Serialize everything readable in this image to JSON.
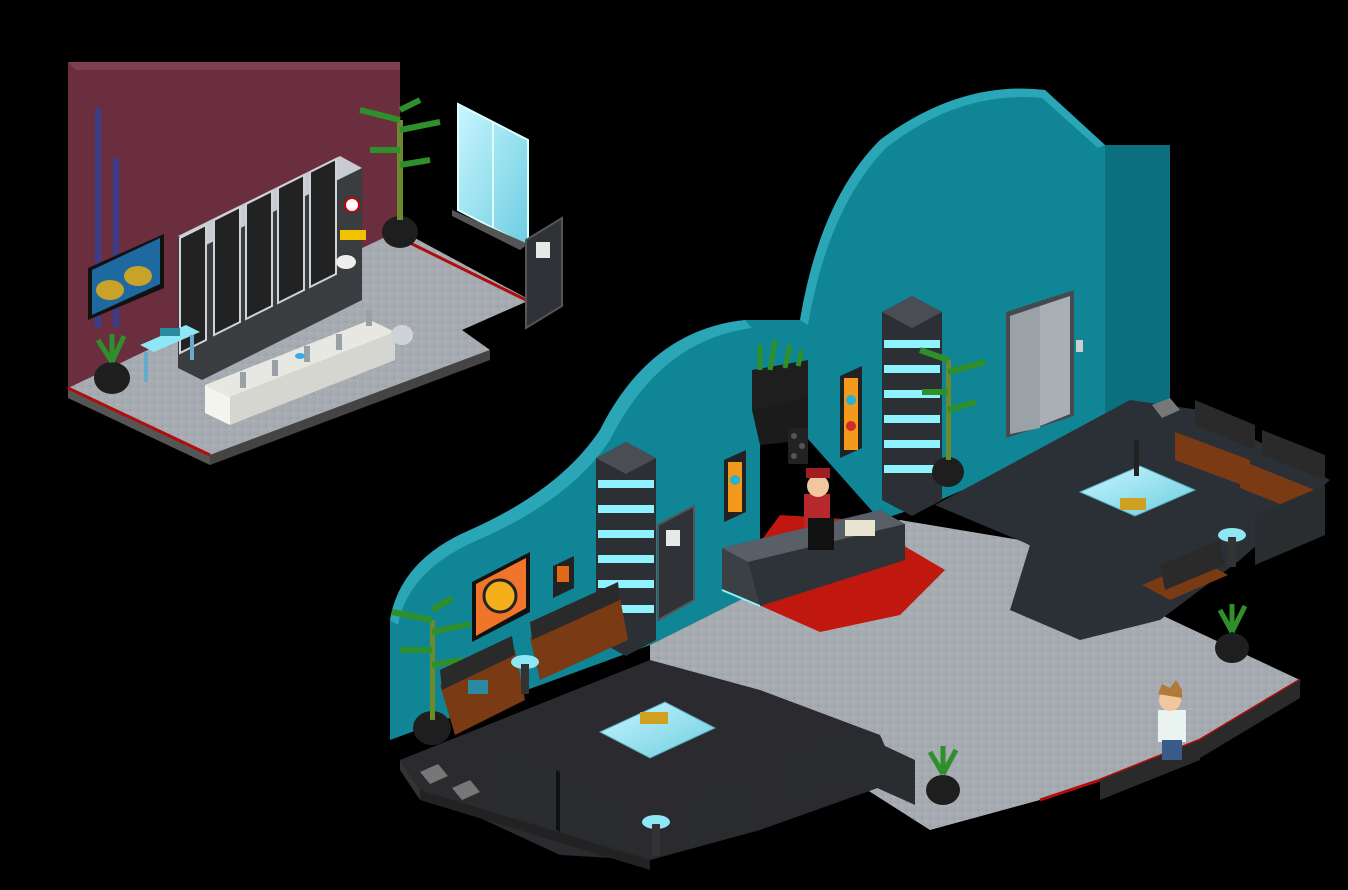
{
  "scene": {
    "background": "#000000",
    "rooms": [
      {
        "id": "restroom",
        "wall_color": "#6a2e3e",
        "floor_color": "#9a9fa6"
      },
      {
        "id": "lobby",
        "wall_color": "#0f8596",
        "floor_color": "#a7acb2",
        "carpet_color": "#2a3036",
        "rug_color": "#c0180e"
      }
    ],
    "colors": {
      "pillar_light": "#8ff3ff",
      "pillar_dark": "#2c2f33",
      "sofa_wood": "#7a3a14",
      "sofa_cushion": "#2a2a2a",
      "glass": "#8fe6f5",
      "plant": "#2f8f2a",
      "red_trim": "#b00d0d"
    },
    "icons": [
      "toilet-sign-icon",
      "no-smoking-sign-icon",
      "elevator-button-icon"
    ]
  }
}
